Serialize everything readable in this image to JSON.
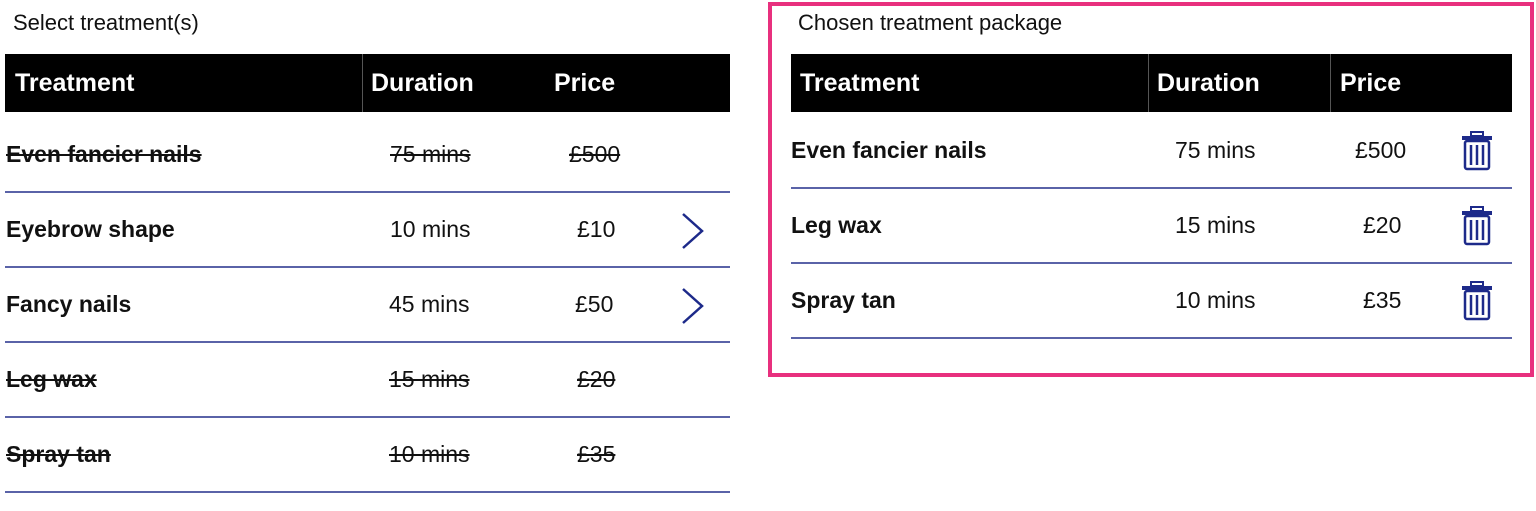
{
  "left": {
    "title": "Select treatment(s)",
    "headers": {
      "treatment": "Treatment",
      "duration": "Duration",
      "price": "Price"
    },
    "rows": [
      {
        "name": "Even fancier nails",
        "duration": "75 mins",
        "price": "£500",
        "disabled": true
      },
      {
        "name": "Eyebrow shape",
        "duration": "10 mins",
        "price": "£10",
        "disabled": false
      },
      {
        "name": "Fancy nails",
        "duration": "45 mins",
        "price": "£50",
        "disabled": false
      },
      {
        "name": "Leg wax",
        "duration": "15 mins",
        "price": "£20",
        "disabled": true
      },
      {
        "name": "Spray tan",
        "duration": "10 mins",
        "price": "£35",
        "disabled": true
      }
    ]
  },
  "right": {
    "title": "Chosen treatment package",
    "headers": {
      "treatment": "Treatment",
      "duration": "Duration",
      "price": "Price"
    },
    "rows": [
      {
        "name": "Even fancier nails",
        "duration": "75 mins",
        "price": "£500"
      },
      {
        "name": "Leg wax",
        "duration": "15 mins",
        "price": "£20"
      },
      {
        "name": "Spray tan",
        "duration": "10 mins",
        "price": "£35"
      }
    ]
  },
  "colors": {
    "accent_border": "#e8307e",
    "icon": "#1d2a8a",
    "divider": "#5a63a8",
    "header_bg": "#000000"
  },
  "icons": {
    "select_row": "chevron-right-icon",
    "remove_row": "trash-icon"
  }
}
